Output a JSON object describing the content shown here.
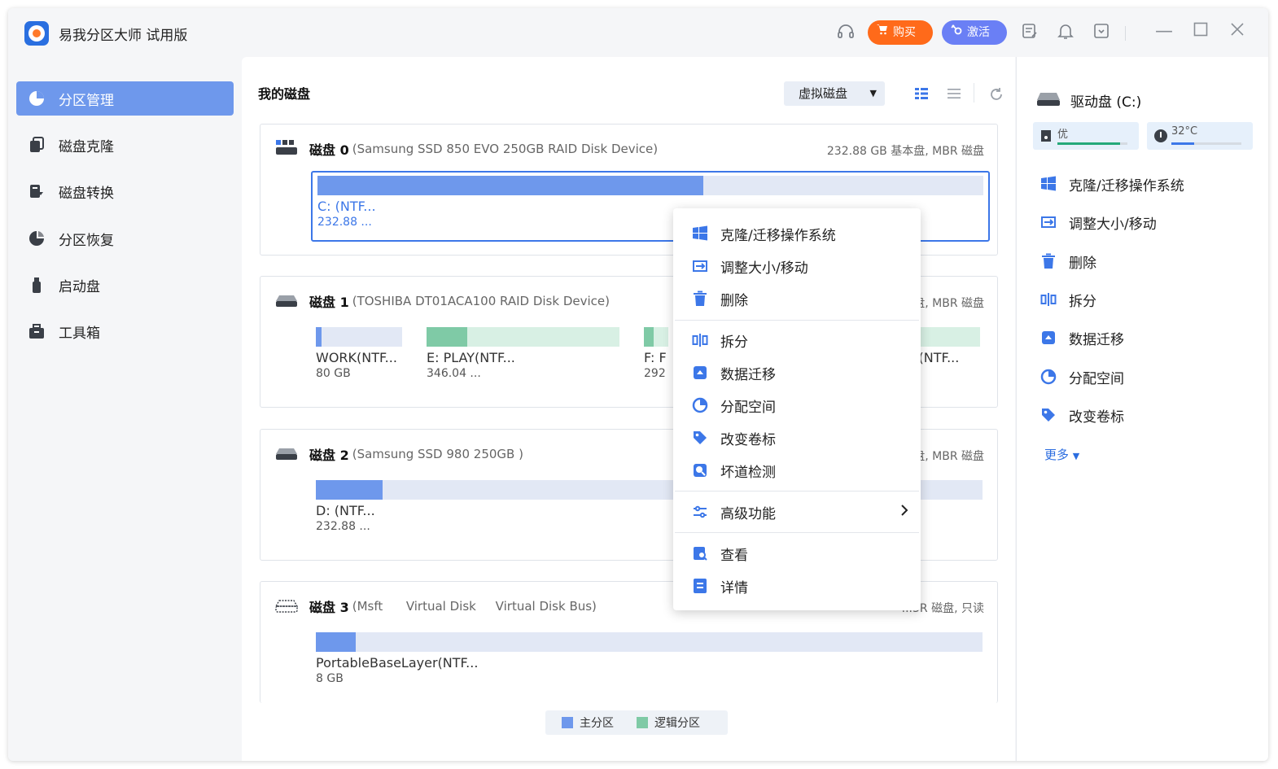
{
  "app": {
    "title": "易我分区大师 试用版"
  },
  "titlebar": {
    "buy_label": "购买",
    "activate_label": "激活",
    "buy_color": "#ff6a1a",
    "activate_color": "#6a7ff5"
  },
  "sidebar": {
    "items": [
      {
        "label": "分区管理",
        "icon": "pie-chart-icon",
        "active": true
      },
      {
        "label": "磁盘克隆",
        "icon": "clone-icon"
      },
      {
        "label": "磁盘转换",
        "icon": "convert-icon"
      },
      {
        "label": "分区恢复",
        "icon": "recovery-icon"
      },
      {
        "label": "启动盘",
        "icon": "usb-icon"
      },
      {
        "label": "工具箱",
        "icon": "toolbox-icon"
      }
    ]
  },
  "main": {
    "title": "我的磁盘",
    "virtual_disk_label": "虚拟磁盘",
    "disks": [
      {
        "name": "磁盘 0",
        "model": "(Samsung SSD 850 EVO 250GB RAID Disk Device)",
        "info": "232.88 GB 基本盘, MBR 磁盘",
        "partitions": [
          {
            "name": "C: (NTF...",
            "size": "232.88 ...",
            "used": 0.58
          }
        ]
      },
      {
        "name": "磁盘 1",
        "model": "(TOSHIBA DT01ACA100 RAID Disk Device)",
        "info": "盘, MBR 磁盘",
        "partitions": [
          {
            "name": "WORK(NTF...",
            "size": "80 GB",
            "used": 0.07
          },
          {
            "name": "E: PLAY(NTF...",
            "size": "346.04 ...",
            "used": 0.21
          },
          {
            "name": "F: F",
            "size": "292"
          },
          {
            "name": "ns(NTF..."
          }
        ]
      },
      {
        "name": "磁盘 2",
        "model": "(Samsung SSD 980 250GB )",
        "info": "盘, MBR 磁盘",
        "partitions": [
          {
            "name": "D: (NTF...",
            "size": "232.88 ...",
            "used": 0.1
          }
        ]
      },
      {
        "name": "磁盘 3",
        "model": "(Msft      Virtual Disk     Virtual Disk Bus)",
        "info": "...3R 磁盘, 只读",
        "partitions": [
          {
            "name": "PortableBaseLayer(NTF...",
            "size": "8 GB",
            "used": 0.06
          }
        ]
      }
    ],
    "legend": {
      "primary": "主分区",
      "logical": "逻辑分区",
      "primary_color": "#6e98ec",
      "logical_color": "#7fcaa6"
    }
  },
  "context_menu": {
    "items": [
      {
        "label": "克隆/迁移操作系统",
        "icon": "windows-icon"
      },
      {
        "label": "调整大小/移动",
        "icon": "resize-icon"
      },
      {
        "label": "删除",
        "icon": "trash-icon"
      },
      {
        "label": "拆分",
        "icon": "split-icon"
      },
      {
        "label": "数据迁移",
        "icon": "migrate-icon"
      },
      {
        "label": "分配空间",
        "icon": "allocate-icon"
      },
      {
        "label": "改变卷标",
        "icon": "tag-icon"
      },
      {
        "label": "坏道检测",
        "icon": "scan-icon"
      },
      {
        "label": "高级功能",
        "icon": "sliders-icon",
        "submenu": true
      },
      {
        "label": "查看",
        "icon": "view-icon"
      },
      {
        "label": "详情",
        "icon": "details-icon"
      }
    ]
  },
  "right_panel": {
    "drive_label": "驱动盘  (C:)",
    "health_label": "优",
    "health_level": 0.9,
    "temperature_label": "32°C",
    "temperature_level": 0.32,
    "actions": [
      {
        "label": "克隆/迁移操作系统",
        "icon": "windows-icon"
      },
      {
        "label": "调整大小/移动",
        "icon": "resize-icon"
      },
      {
        "label": "删除",
        "icon": "trash-icon"
      },
      {
        "label": "拆分",
        "icon": "split-icon"
      },
      {
        "label": "数据迁移",
        "icon": "migrate-icon"
      },
      {
        "label": "分配空间",
        "icon": "allocate-icon"
      },
      {
        "label": "改变卷标",
        "icon": "tag-icon"
      }
    ],
    "more_label": "更多"
  }
}
